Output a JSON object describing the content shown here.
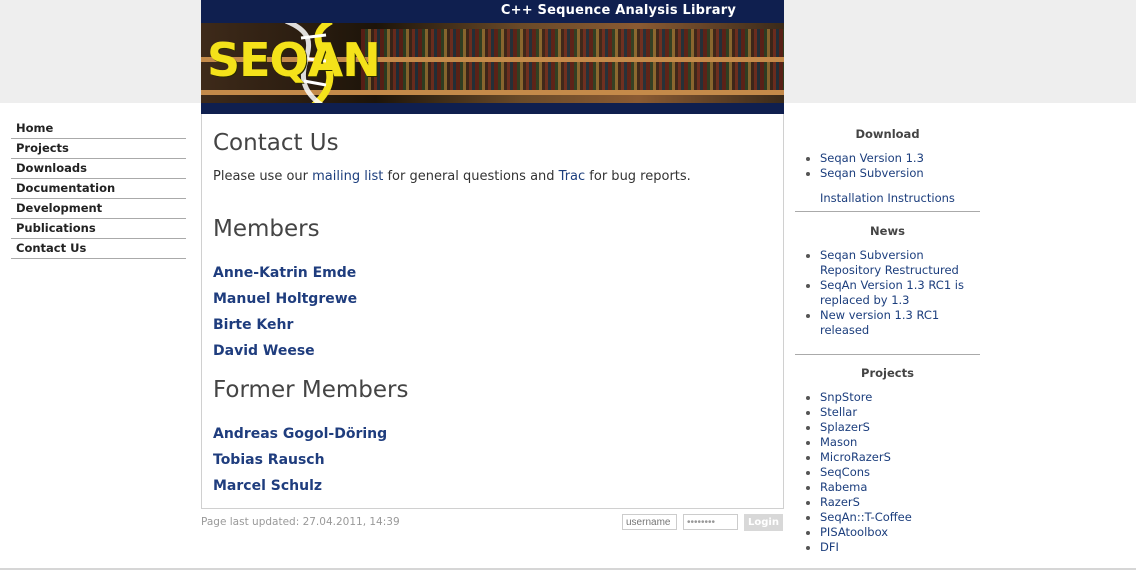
{
  "header": {
    "tagline": "C++ Sequence Analysis Library",
    "logo_text": "SEQAN"
  },
  "nav": {
    "items": [
      {
        "label": "Home"
      },
      {
        "label": "Projects"
      },
      {
        "label": "Downloads"
      },
      {
        "label": "Documentation"
      },
      {
        "label": "Development"
      },
      {
        "label": "Publications"
      },
      {
        "label": "Contact Us"
      }
    ]
  },
  "main": {
    "title": "Contact Us",
    "intro": {
      "prefix": "Please use our ",
      "mailing_link": "mailing list",
      "middle": " for general questions and ",
      "trac_link": "Trac",
      "suffix": " for bug reports."
    },
    "members_heading": "Members",
    "members": [
      "Anne-Katrin Emde",
      "Manuel Holtgrewe",
      "Birte Kehr",
      "David Weese"
    ],
    "former_heading": "Former Members",
    "former_members": [
      "Andreas Gogol-Döring",
      "Tobias Rausch",
      "Marcel Schulz"
    ]
  },
  "footer": {
    "updated": "Page last updated: 27.04.2011, 14:39",
    "username_placeholder": "username",
    "password_value": "••••••••",
    "login_label": "Login"
  },
  "sidebar": {
    "download": {
      "title": "Download",
      "items": [
        "Seqan Version 1.3",
        "Seqan Subversion"
      ],
      "extra": "Installation Instructions"
    },
    "news": {
      "title": "News",
      "items": [
        "Seqan Subversion Repository Restructured",
        "SeqAn Version 1.3 RC1 is replaced by 1.3",
        "New version 1.3 RC1 released"
      ]
    },
    "projects": {
      "title": "Projects",
      "items": [
        "SnpStore",
        "Stellar",
        "SplazerS",
        "Mason",
        "MicroRazerS",
        "SeqCons",
        "Rabema",
        "RazerS",
        "SeqAn::T-Coffee",
        "PISAtoolbox",
        "DFI"
      ]
    }
  }
}
